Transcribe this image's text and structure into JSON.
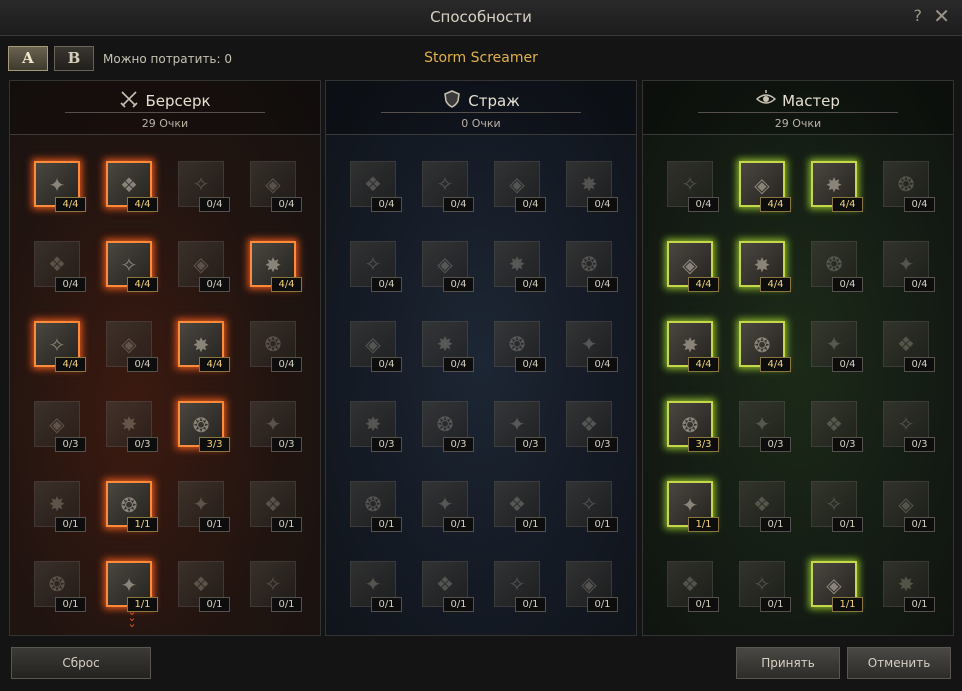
{
  "window": {
    "title": "Способности",
    "help_icon": "?",
    "close_icon": "✕"
  },
  "presets": [
    "A",
    "B"
  ],
  "points_label": "Можно потратить:  0",
  "class_name": "Storm Screamer",
  "trees": [
    {
      "name": "Берсерк",
      "icon": "crossed-swords-icon",
      "points": "29 Очки",
      "glow": "red",
      "levels": [
        [
          "4/4",
          "4/4",
          "0/4",
          "0/4"
        ],
        [
          "0/4",
          "4/4",
          "0/4",
          "4/4"
        ],
        [
          "4/4",
          "0/4",
          "4/4",
          "0/4"
        ],
        [
          "0/3",
          "0/3",
          "3/3",
          "0/3"
        ],
        [
          "0/1",
          "1/1",
          "0/1",
          "0/1"
        ],
        [
          "0/1",
          "1/1",
          "0/1",
          "0/1"
        ]
      ]
    },
    {
      "name": "Страж",
      "icon": "shield-icon",
      "points": "0 Очки",
      "glow": "none",
      "levels": [
        [
          "0/4",
          "0/4",
          "0/4",
          "0/4"
        ],
        [
          "0/4",
          "0/4",
          "0/4",
          "0/4"
        ],
        [
          "0/4",
          "0/4",
          "0/4",
          "0/4"
        ],
        [
          "0/3",
          "0/3",
          "0/3",
          "0/3"
        ],
        [
          "0/1",
          "0/1",
          "0/1",
          "0/1"
        ],
        [
          "0/1",
          "0/1",
          "0/1",
          "0/1"
        ]
      ]
    },
    {
      "name": "Мастер",
      "icon": "eye-icon",
      "points": "29 Очки",
      "glow": "green",
      "levels": [
        [
          "0/4",
          "4/4",
          "4/4",
          "0/4"
        ],
        [
          "4/4",
          "4/4",
          "0/4",
          "0/4"
        ],
        [
          "4/4",
          "4/4",
          "0/4",
          "0/4"
        ],
        [
          "3/3",
          "0/3",
          "0/3",
          "0/3"
        ],
        [
          "1/1",
          "0/1",
          "0/1",
          "0/1"
        ],
        [
          "0/1",
          "0/1",
          "1/1",
          "0/1"
        ]
      ]
    }
  ],
  "buttons": {
    "reset": "Сброс",
    "accept": "Принять",
    "cancel": "Отменить"
  },
  "colors": {
    "accent_gold": "#e0b24a",
    "learned_red": "#ff8a3a",
    "learned_green": "#c6d84a"
  }
}
